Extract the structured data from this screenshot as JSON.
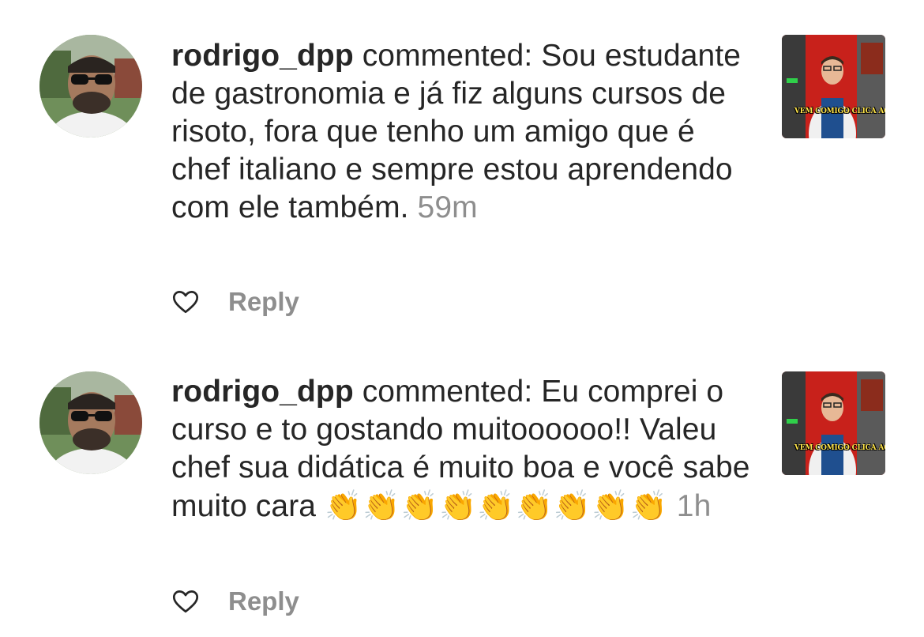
{
  "comments": [
    {
      "username": "rodrigo_dpp",
      "verb": "commented:",
      "text": "Sou estudante de gastronomia e já fiz alguns cursos de risoto, fora que tenho um amigo que é chef italiano e sempre estou aprendendo com ele também.",
      "claps": "",
      "time": "59m",
      "reply_label": "Reply",
      "thumbnail_caption": "VEM COMIGO CLICA AQUI E",
      "avatar_icon": "profile-photo",
      "like_icon": "heart-outline-icon"
    },
    {
      "username": "rodrigo_dpp",
      "verb": "commented:",
      "text": "Eu comprei o curso e to gostando muitoooooo!! Valeu chef sua didática é muito boa e você sabe muito cara",
      "claps": "👏👏👏👏👏👏👏👏👏",
      "time": "1h",
      "reply_label": "Reply",
      "thumbnail_caption": "VEM COMIGO CLICA AQUI E",
      "avatar_icon": "profile-photo",
      "like_icon": "heart-outline-icon"
    }
  ],
  "colors": {
    "text": "#262626",
    "secondary": "#8e8e8e",
    "background": "#ffffff",
    "thumbnail_red": "#c8211b",
    "caption_yellow": "#ffe54a"
  }
}
